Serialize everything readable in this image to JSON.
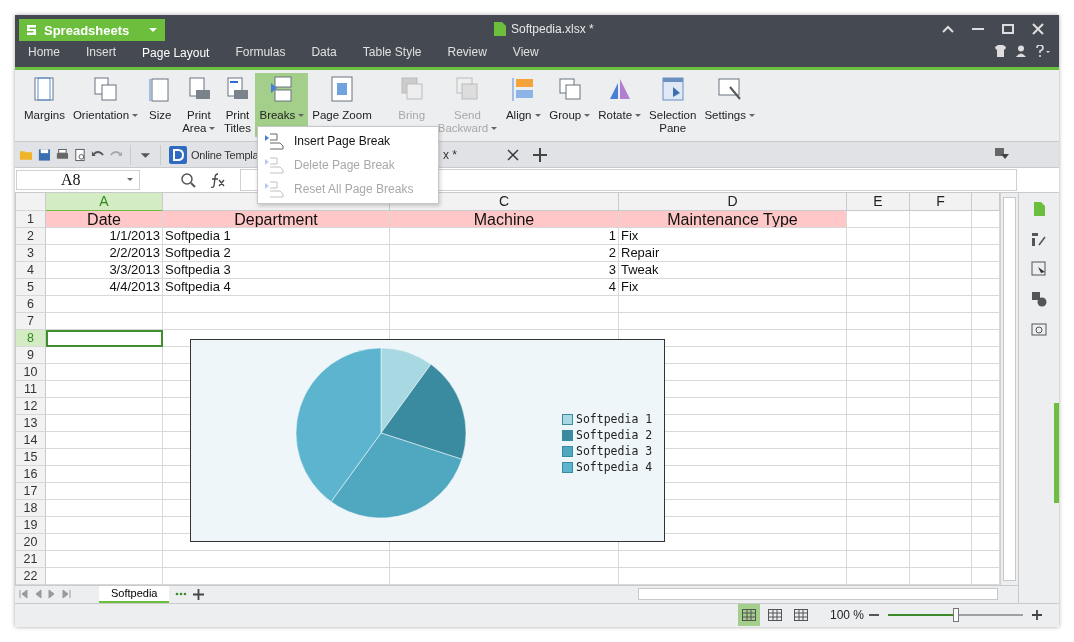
{
  "app": {
    "name": "Spreadsheets"
  },
  "window": {
    "title": "Softpedia.xlsx *"
  },
  "menu_tabs": [
    {
      "label": "Home",
      "selected": false
    },
    {
      "label": "Insert",
      "selected": false
    },
    {
      "label": "Page Layout",
      "selected": true
    },
    {
      "label": "Formulas",
      "selected": false
    },
    {
      "label": "Data",
      "selected": false
    },
    {
      "label": "Table Style",
      "selected": false
    },
    {
      "label": "Review",
      "selected": false
    },
    {
      "label": "View",
      "selected": false
    }
  ],
  "ribbon": [
    {
      "lines": [
        "Margins"
      ],
      "dropdown": false,
      "disabled": false,
      "selected": false
    },
    {
      "lines": [
        "Orientation"
      ],
      "dropdown": true,
      "disabled": false,
      "selected": false
    },
    {
      "lines": [
        "Size"
      ],
      "dropdown": false,
      "disabled": false,
      "selected": false
    },
    {
      "lines": [
        "Print",
        "Area"
      ],
      "dropdown": true,
      "disabled": false,
      "selected": false
    },
    {
      "lines": [
        "Print",
        "Titles"
      ],
      "dropdown": false,
      "disabled": false,
      "selected": false
    },
    {
      "lines": [
        "Breaks"
      ],
      "dropdown": true,
      "disabled": false,
      "selected": true
    },
    {
      "lines": [
        "Page Zoom"
      ],
      "dropdown": false,
      "disabled": false,
      "selected": false
    },
    {
      "lines": [
        "Bring"
      ],
      "dropdown": false,
      "disabled": true,
      "selected": false
    },
    {
      "lines": [
        "Send",
        "Backward"
      ],
      "dropdown": true,
      "disabled": true,
      "selected": false
    },
    {
      "lines": [
        "Align"
      ],
      "dropdown": true,
      "disabled": false,
      "selected": false
    },
    {
      "lines": [
        "Group"
      ],
      "dropdown": true,
      "disabled": false,
      "selected": false
    },
    {
      "lines": [
        "Rotate"
      ],
      "dropdown": true,
      "disabled": false,
      "selected": false
    },
    {
      "lines": [
        "Selection",
        "Pane"
      ],
      "dropdown": false,
      "disabled": false,
      "selected": false
    },
    {
      "lines": [
        "Settings"
      ],
      "dropdown": true,
      "disabled": false,
      "selected": false
    }
  ],
  "breaks_menu": [
    {
      "label": "Insert Page Break",
      "disabled": false
    },
    {
      "label": "Delete Page Break",
      "disabled": true
    },
    {
      "label": "Reset All Page Breaks",
      "disabled": true
    }
  ],
  "doc_tabs": [
    {
      "label": "Online Templa"
    },
    {
      "label": "x *",
      "closable": true
    }
  ],
  "formula_bar": {
    "cell_ref": "A8"
  },
  "columns": [
    {
      "label": "A",
      "selected": true
    },
    {
      "selected": false
    },
    {
      "label": "C",
      "selected": false
    },
    {
      "label": "D",
      "selected": false
    },
    {
      "label": "E",
      "selected": false
    },
    {
      "label": "F",
      "selected": false
    }
  ],
  "rows": [
    {
      "number": "1",
      "kind": "header",
      "selected": false,
      "cells": [
        "Date",
        "Department",
        "Machine",
        "Maintenance Type"
      ]
    },
    {
      "number": "2",
      "kind": "data",
      "selected": false,
      "cells": [
        "1/1/2013",
        "Softpedia 1",
        "1",
        "Fix"
      ]
    },
    {
      "number": "3",
      "kind": "data",
      "selected": false,
      "cells": [
        "2/2/2013",
        "Softpedia 2",
        "2",
        "Repair"
      ]
    },
    {
      "number": "4",
      "kind": "data",
      "selected": false,
      "cells": [
        "3/3/2013",
        "Softpedia 3",
        "3",
        "Tweak"
      ]
    },
    {
      "number": "5",
      "kind": "data",
      "selected": false,
      "cells": [
        "4/4/2013",
        "Softpedia 4",
        "4",
        "Fix"
      ]
    },
    {
      "number": "6",
      "selected": false
    },
    {
      "number": "7",
      "selected": false
    },
    {
      "number": "8",
      "selected": true
    },
    {
      "number": "9",
      "selected": false
    },
    {
      "number": "10",
      "selected": false
    },
    {
      "number": "11",
      "selected": false
    },
    {
      "number": "12",
      "selected": false
    },
    {
      "number": "13",
      "selected": false
    },
    {
      "number": "14",
      "selected": false
    },
    {
      "number": "15",
      "selected": false
    },
    {
      "number": "16",
      "selected": false
    },
    {
      "number": "17",
      "selected": false
    },
    {
      "number": "18",
      "selected": false
    },
    {
      "number": "19",
      "selected": false
    },
    {
      "number": "20",
      "selected": false
    },
    {
      "number": "21",
      "selected": false
    },
    {
      "number": "22",
      "selected": false
    }
  ],
  "chart": {
    "chart_data": {
      "type": "pie",
      "categories": [
        "Softpedia 1",
        "Softpedia 2",
        "Softpedia 3",
        "Softpedia 4"
      ],
      "series": [
        {
          "values": [
            1,
            2,
            3,
            4
          ]
        }
      ],
      "colors": [
        "#a8d8e2",
        "#3a8aa0",
        "#4fa8c0",
        "#5cb4cf"
      ]
    }
  },
  "sheet_tabs": [
    {
      "label": "Softpedia",
      "selected": true
    }
  ],
  "status_bar": {
    "views": [
      {
        "selected": true
      },
      {
        "selected": false
      },
      {
        "selected": false
      }
    ],
    "zoom": "100 %",
    "zoom_level": {
      "level": 0.5
    }
  }
}
